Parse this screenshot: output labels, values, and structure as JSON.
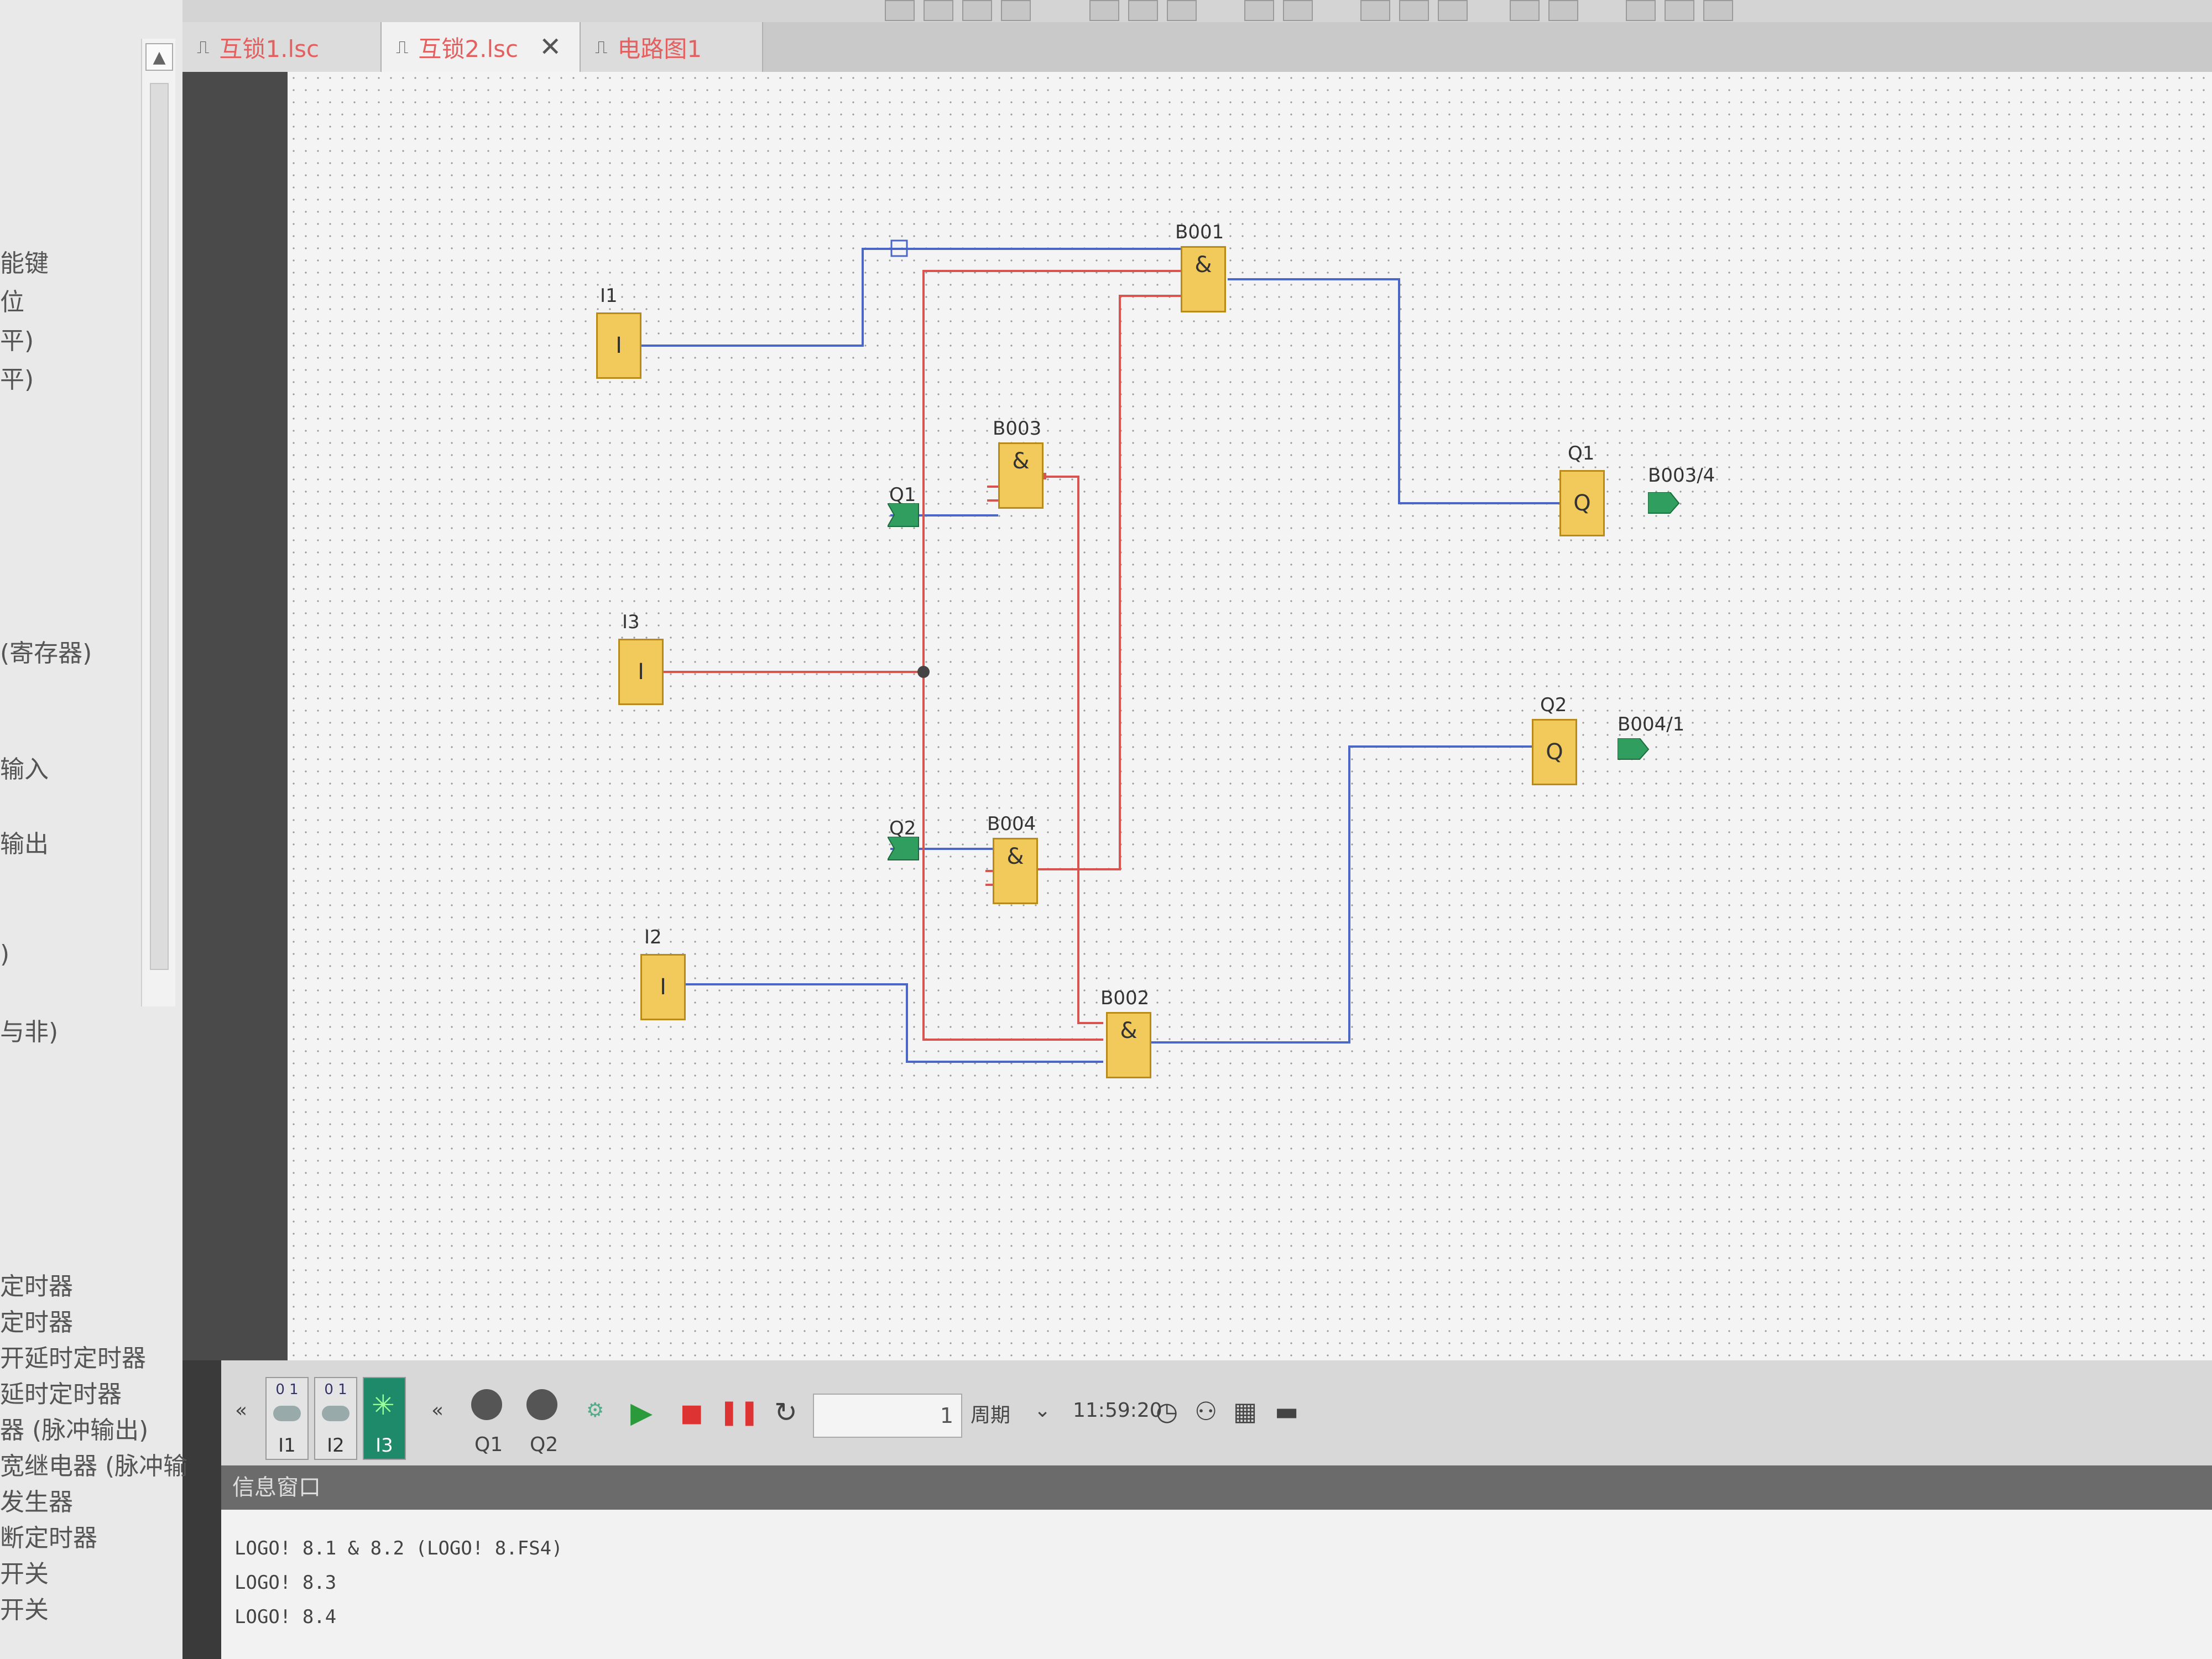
{
  "tabs": [
    {
      "label": "互锁1.lsc",
      "active": false,
      "closable": false
    },
    {
      "label": "互锁2.lsc",
      "active": true,
      "closable": true
    },
    {
      "label": "电路图1",
      "active": false,
      "closable": false
    }
  ],
  "left_panel": {
    "items": [
      "能键",
      "位",
      "平)",
      "平)",
      "(寄存器)",
      "输入",
      "输出",
      ")",
      "与非)",
      "定时器",
      "定时器",
      "开延时定时器",
      "延时定时器",
      "器 (脉冲输出)",
      "宽继电器 (脉冲输",
      "发生器",
      "断定时器",
      "开关",
      "开关"
    ]
  },
  "diagram": {
    "inputs": [
      {
        "name": "I1",
        "symbol": "I"
      },
      {
        "name": "I3",
        "symbol": "I"
      },
      {
        "name": "I2",
        "symbol": "I"
      }
    ],
    "and_blocks": [
      {
        "name": "B001",
        "symbol": "&"
      },
      {
        "name": "B003",
        "symbol": "&"
      },
      {
        "name": "B004",
        "symbol": "&"
      },
      {
        "name": "B002",
        "symbol": "&"
      }
    ],
    "outputs": [
      {
        "name": "Q1",
        "symbol": "Q",
        "ref": "B003/4"
      },
      {
        "name": "Q2",
        "symbol": "Q",
        "ref": "B004/1"
      }
    ],
    "flags": [
      {
        "name": "Q1"
      },
      {
        "name": "Q2"
      }
    ],
    "colors": {
      "signal_low": "#4a67c8",
      "signal_high": "#d9534f",
      "block_fill": "#f2c95b",
      "flag": "#2f9e5e"
    }
  },
  "simulation": {
    "switches": [
      {
        "label": "I1",
        "state": "off",
        "scale": "0 1"
      },
      {
        "label": "I2",
        "state": "off",
        "scale": "0 1"
      },
      {
        "label": "I3",
        "state": "on"
      }
    ],
    "lamps": [
      {
        "label": "Q1"
      },
      {
        "label": "Q2"
      }
    ],
    "cycles_value": "1",
    "cycles_unit": "周期",
    "time": "11:59:20",
    "icons": [
      "collapse-icon",
      "play-icon",
      "stop-icon",
      "pause-icon",
      "reset-icon",
      "clock-icon",
      "network-icon",
      "calendar-icon",
      "folder-icon"
    ]
  },
  "info_window": {
    "title": "信息窗口",
    "lines": [
      "LOGO! 8.1 & 8.2 (LOGO! 8.FS4)",
      "LOGO! 8.3",
      "LOGO! 8.4"
    ]
  }
}
